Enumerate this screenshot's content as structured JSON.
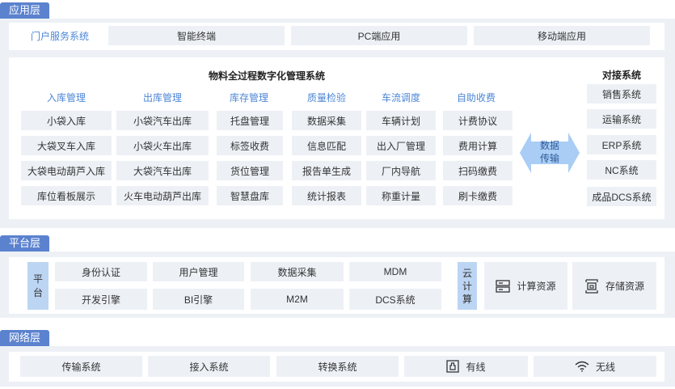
{
  "app_layer": {
    "tag": "应用层",
    "portal": "门户服务系统",
    "top_items": [
      "智能终端",
      "PC端应用",
      "移动端应用"
    ],
    "system_title": "物料全过程数字化管理系统",
    "columns": [
      {
        "header": "入库管理",
        "items": [
          "小袋入库",
          "大袋叉车入库",
          "大袋电动葫芦入库",
          "库位看板展示"
        ]
      },
      {
        "header": "出库管理",
        "items": [
          "小袋汽车出库",
          "小袋火车出库",
          "大袋汽车出库",
          "火车电动葫芦出库"
        ]
      },
      {
        "header": "库存管理",
        "items": [
          "托盘管理",
          "标签收费",
          "货位管理",
          "智慧盘库"
        ]
      },
      {
        "header": "质量检验",
        "items": [
          "数据采集",
          "信息匹配",
          "报告单生成",
          "统计报表"
        ]
      },
      {
        "header": "车流调度",
        "items": [
          "车辆计划",
          "出入厂管理",
          "厂内导航",
          "称重计量"
        ]
      },
      {
        "header": "自助收费",
        "items": [
          "计费协议",
          "费用计算",
          "扫码缴费",
          "刷卡缴费"
        ]
      }
    ],
    "transfer": [
      "数据",
      "传输"
    ],
    "docking": {
      "title": "对接系统",
      "items": [
        "销售系统",
        "运输系统",
        "ERP系统",
        "NC系统",
        "成品DCS系统"
      ]
    }
  },
  "platform_layer": {
    "tag": "平台层",
    "platform_label": [
      "平",
      "台"
    ],
    "items_row1": [
      "身份认证",
      "用户管理",
      "数据采集",
      "MDM"
    ],
    "items_row2": [
      "开发引擎",
      "BI引擎",
      "M2M",
      "DCS系统"
    ],
    "cloud_label": [
      "云",
      "计",
      "算"
    ],
    "resources": [
      {
        "label": "计算资源",
        "icon": "server-icon"
      },
      {
        "label": "存储资源",
        "icon": "storage-icon"
      }
    ]
  },
  "network_layer": {
    "tag": "网络层",
    "items": [
      "传输系统",
      "接入系统",
      "转换系统"
    ],
    "wired": {
      "label": "有线",
      "icon": "wired-port-icon"
    },
    "wireless": {
      "label": "无线",
      "icon": "wifi-icon"
    }
  },
  "colors": {
    "accent": "#5b82cf",
    "header_text": "#4c86d6",
    "cell_bg": "#edf1f6",
    "band_bg": "#edf1f6",
    "cloud_bg": "#bcd5f3",
    "transfer_arrow": "#a9cdf4"
  }
}
